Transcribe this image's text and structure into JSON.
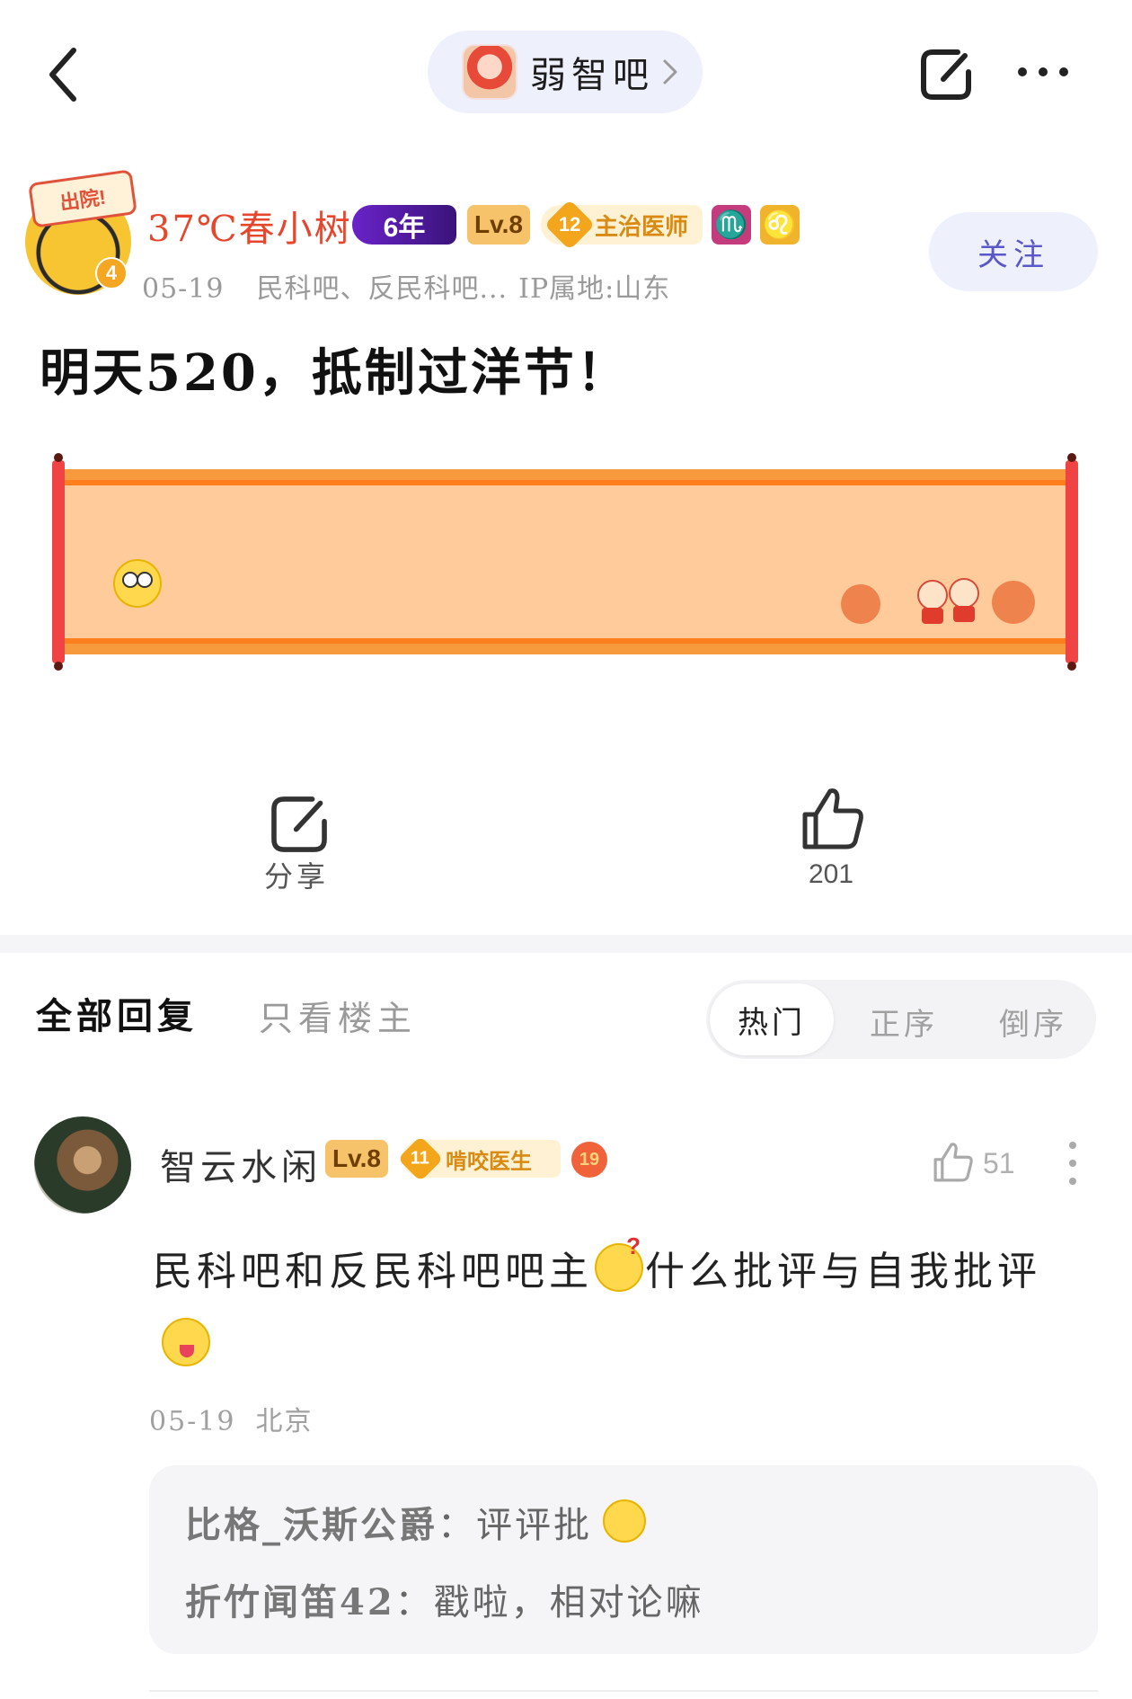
{
  "topbar": {
    "forum_name": "弱智吧",
    "icons": [
      "back-arrow-icon",
      "chevron-right-icon",
      "share-icon",
      "more-icon"
    ]
  },
  "post": {
    "author": {
      "name": "37℃春小树",
      "avatar_badge": "4",
      "avatar_hat_text": "出院!",
      "years_badge": "6年",
      "level": "Lv.8",
      "doctor_level": "12",
      "doctor_title": "主治医师",
      "zodiac_1": "♏",
      "zodiac_2": "♌"
    },
    "date": "05-19",
    "forums": "民科吧、反民科吧...",
    "ip": "IP属地:山东",
    "follow_label": "关注",
    "title": "明天520，抵制过洋节！",
    "share_label": "分享",
    "like_count": "201"
  },
  "replies": {
    "tab_all": "全部回复",
    "tab_host_only": "只看楼主",
    "sort_hot": "热门",
    "sort_asc": "正序",
    "sort_desc": "倒序"
  },
  "comment": {
    "user": "智云水闲",
    "level": "Lv.8",
    "doctor_level": "11",
    "doctor_title": "啃咬医生",
    "badge": "19",
    "likes": "51",
    "text_part1": "民科吧和反民科吧吧主",
    "text_part2": "什么批评与自我批评",
    "date": "05-19",
    "location": "北京",
    "sub_replies": [
      {
        "user": "比格_沃斯公爵",
        "sep": "：",
        "text": "评评批"
      },
      {
        "user": "折竹闻笛42",
        "sep": "：",
        "text": "戳啦，相对论嘛"
      }
    ]
  },
  "colors": {
    "accent_purple": "#5a57c8",
    "author_name_red": "#e6462c",
    "pill_bg": "#eef0fb",
    "banner_fill": "#ffcb9a",
    "banner_border": "#f79a3e"
  }
}
